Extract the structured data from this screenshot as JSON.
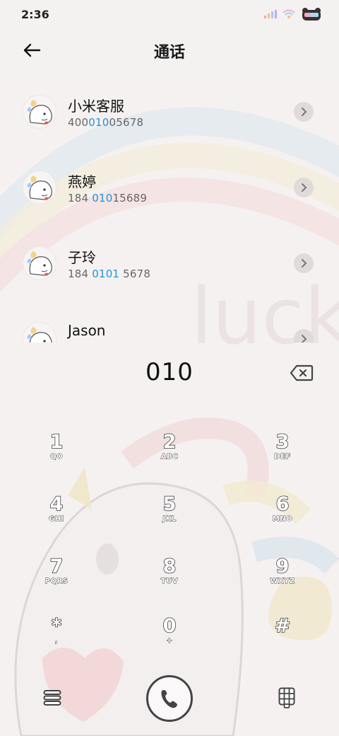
{
  "status": {
    "time": "2:36"
  },
  "header": {
    "title": "通话"
  },
  "contacts": [
    {
      "name": "小米客服",
      "num_pre": "400",
      "num_hl": "010",
      "num_post": "05678"
    },
    {
      "name": "燕婷",
      "num_pre": "184 ",
      "num_hl": "010",
      "num_post": "15689"
    },
    {
      "name": "子玲",
      "num_pre": "184 ",
      "num_hl": "0101",
      "num_post": " 5678"
    },
    {
      "name": "Jason",
      "num_pre": "",
      "num_hl": "",
      "num_post": ""
    }
  ],
  "dialpad": {
    "input": "010",
    "keys": [
      {
        "digit": "1",
        "letters": "QO"
      },
      {
        "digit": "2",
        "letters": "ABC"
      },
      {
        "digit": "3",
        "letters": "DEF"
      },
      {
        "digit": "4",
        "letters": "GHI"
      },
      {
        "digit": "5",
        "letters": "JKL"
      },
      {
        "digit": "6",
        "letters": "MNO"
      },
      {
        "digit": "7",
        "letters": "PQRS"
      },
      {
        "digit": "8",
        "letters": "TUV"
      },
      {
        "digit": "9",
        "letters": "WXYZ"
      },
      {
        "digit": "*",
        "letters": ","
      },
      {
        "digit": "0",
        "letters": "+"
      },
      {
        "digit": "#",
        "letters": ""
      }
    ]
  },
  "icons": {
    "back": "arrow-left-icon",
    "chevron": "chevron-right-icon",
    "delete": "backspace-icon",
    "menu": "menu-icon",
    "call": "phone-icon",
    "keypad": "keypad-icon"
  },
  "colors": {
    "highlight": "#1f93d8",
    "background": "#f6f1f1"
  }
}
